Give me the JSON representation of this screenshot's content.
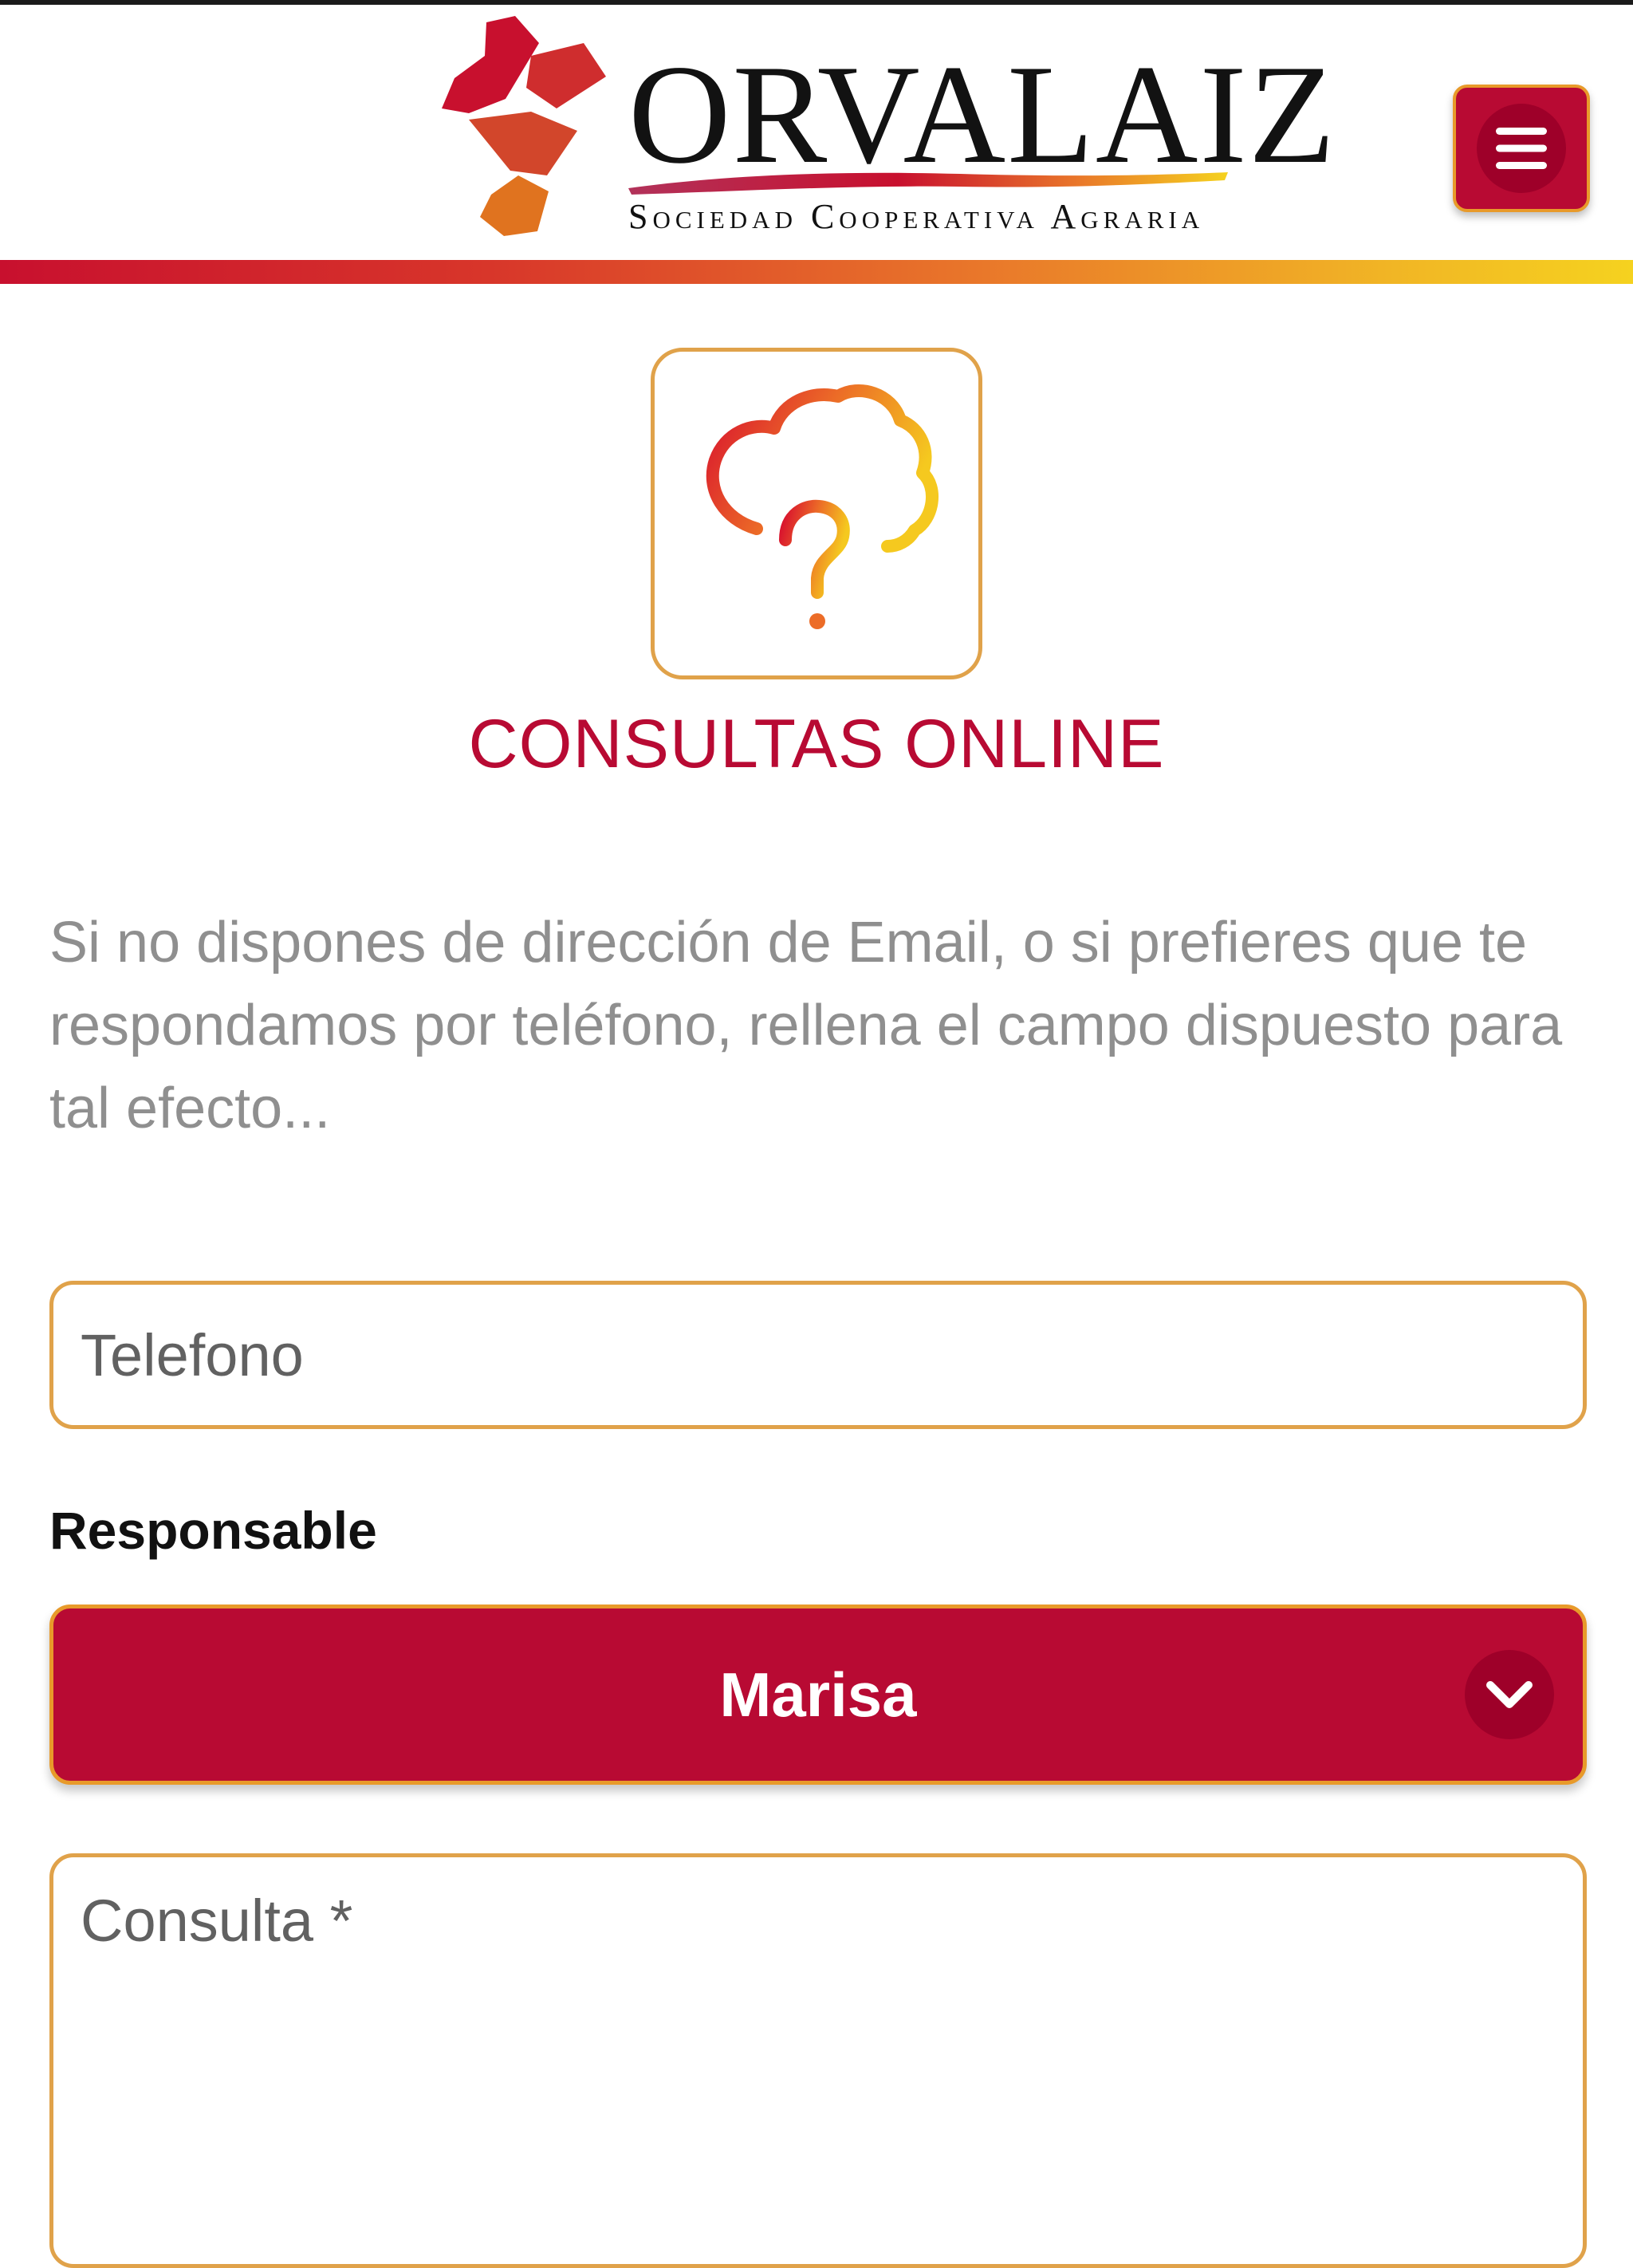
{
  "brand": {
    "name": "ORVALAIZ",
    "subtitle": "Sociedad Cooperativa Agraria",
    "colors": {
      "primary": "#b80a33",
      "accent_orange": "#e0a24a",
      "gradient_start": "#c8102e",
      "gradient_end": "#f5d21f"
    }
  },
  "header": {
    "menu_icon": "hamburger-menu-icon"
  },
  "section": {
    "icon": "cloud-question-icon",
    "title": "CONSULTAS ONLINE"
  },
  "form": {
    "intro": "Si no dispones de dirección de Email, o si prefieres que te respondamos por teléfono, rellena el campo dispuesto para tal efecto...",
    "phone": {
      "placeholder": "Telefono",
      "value": ""
    },
    "responsable": {
      "label": "Responsable",
      "selected": "Marisa",
      "icon": "chevron-down-icon"
    },
    "query": {
      "placeholder": "Consulta *",
      "value": ""
    }
  }
}
